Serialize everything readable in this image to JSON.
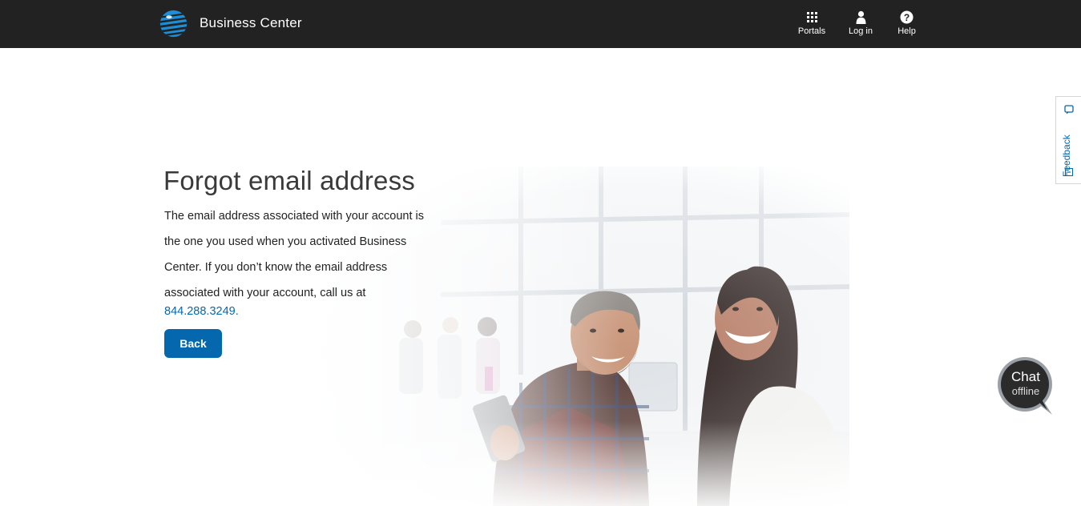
{
  "header": {
    "brand": "Business Center",
    "nav": [
      {
        "label": "Portals",
        "icon": "grid-icon"
      },
      {
        "label": "Log in",
        "icon": "user-icon"
      },
      {
        "label": "Help",
        "icon": "help-icon"
      }
    ]
  },
  "main": {
    "title": "Forgot email address",
    "paragraph_lines": [
      "The email address associated with your account is",
      "the one you used when you activated Business",
      "Center. If you don’t know the email address",
      "associated with your account, call us at"
    ],
    "phone": "844.288.3249.",
    "back_label": "Back"
  },
  "feedback": {
    "label": "Feedback"
  },
  "chat": {
    "line1": "Chat",
    "line2": "offline"
  },
  "colors": {
    "header_bg": "#222222",
    "accent": "#0568ae",
    "logo": "#1d8fd8"
  }
}
